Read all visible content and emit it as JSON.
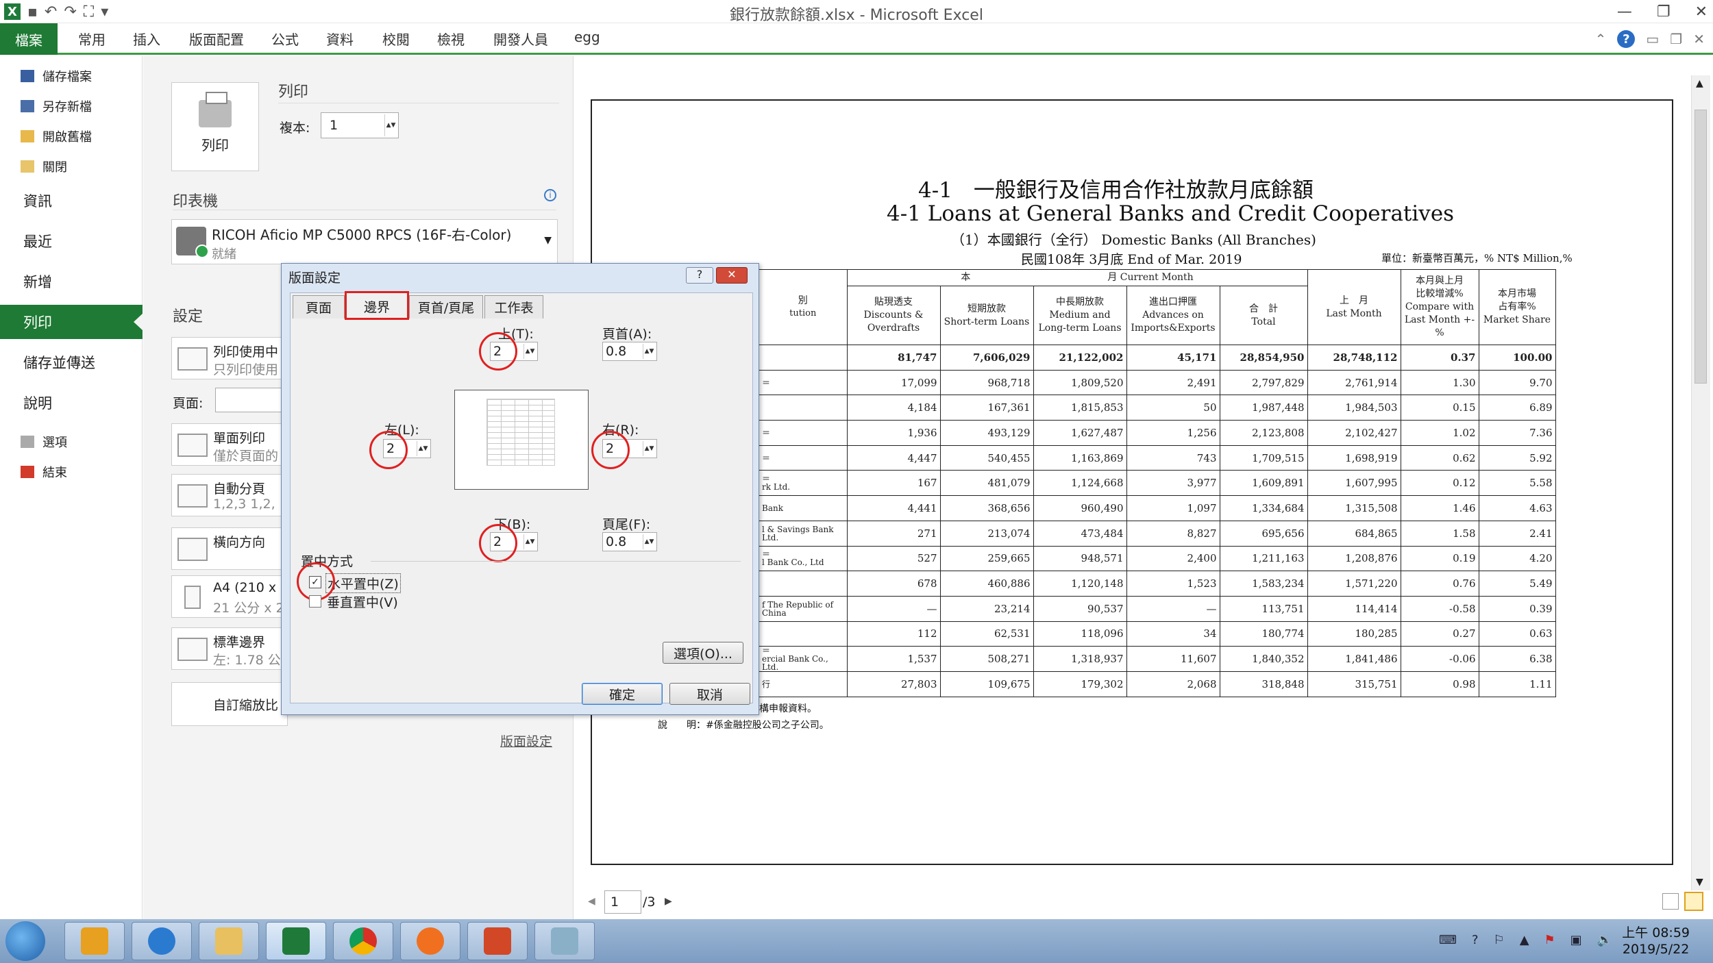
{
  "window": {
    "title": "銀行放款餘額.xlsx - Microsoft Excel",
    "tabs": [
      "檔案",
      "常用",
      "插入",
      "版面配置",
      "公式",
      "資料",
      "校閱",
      "檢視",
      "開發人員",
      "egg"
    ]
  },
  "nav": {
    "small_top": [
      "儲存檔案",
      "另存新檔",
      "開啟舊檔",
      "關閉"
    ],
    "big": [
      "資訊",
      "最近",
      "新增",
      "列印",
      "儲存並傳送",
      "說明"
    ],
    "small_bottom": [
      "選項",
      "結束"
    ]
  },
  "print_pane": {
    "title": "列印",
    "print_button": "列印",
    "copies_label": "複本:",
    "copies_value": "1",
    "printer_title": "印表機",
    "printer_name": "RICOH Aficio MP C5000 RPCS (16F-右-Color)",
    "printer_status": "就緒",
    "settings_title": "設定",
    "options": [
      {
        "t1": "列印使用中",
        "t2": "只列印使用"
      },
      {
        "t1": "單面列印",
        "t2": "僅於頁面的"
      },
      {
        "t1": "自動分頁",
        "t2": "1,2,3    1,2,"
      },
      {
        "t1": "橫向方向",
        "t2": ""
      },
      {
        "t1": "A4 (210 x 2",
        "t2": "21 公分 x 2"
      },
      {
        "t1": "標準邊界",
        "t2": "左: 1.78 公"
      }
    ],
    "pages_label": "頁面:",
    "scale_label": "自訂縮放比",
    "page_setup_link": "版面設定"
  },
  "dialog": {
    "title": "版面設定",
    "tabs": [
      "頁面",
      "邊界",
      "頁首/頁尾",
      "工作表"
    ],
    "top_label": "上(T):",
    "top": "2",
    "header_label": "頁首(A):",
    "header": "0.8",
    "left_label": "左(L):",
    "left": "2",
    "right_label": "右(R):",
    "right": "2",
    "bottom_label": "下(B):",
    "bottom": "2",
    "footer_label": "頁尾(F):",
    "footer": "0.8",
    "center_title": "置中方式",
    "horiz": "水平置中(Z)",
    "vert": "垂直置中(V)",
    "options_btn": "選項(O)...",
    "ok": "確定",
    "cancel": "取消"
  },
  "preview": {
    "title_zh": "4-1　一般銀行及信用合作社放款月底餘額",
    "title_en": "4-1 Loans at General Banks and Credit Cooperatives",
    "subtitle": "（1）本國銀行（全行）  Domestic Banks (All Branches)",
    "date": "民國108年  3月底  End of Mar. 2019",
    "unit": "單位：新臺幣百萬元，%  NT$ Million,%",
    "group_zh": "本",
    "group_en": "月  Current Month",
    "row_col_zh": "別",
    "row_col_en": "tution",
    "headers": [
      "貼現透支\nDiscounts &\nOverdrafts",
      "短期放款\nShort-term Loans",
      "中長期放款\nMedium and\nLong-term Loans",
      "進出口押匯\nAdvances on\nImports&Exports",
      "合　計\nTotal",
      "上　月\nLast Month",
      "本月與上月\n比較增減%\nCompare with\nLast Month +-%",
      "本月市場\n占有率%\nMarket Share"
    ],
    "row_labels": [
      "",
      "＝",
      "",
      "＝",
      "＝",
      "＝\nrk Ltd.",
      "Bank",
      "l & Savings Bank Ltd.",
      "＝\nl Bank Co., Ltd",
      "",
      "f The Republic of China",
      "",
      "＝\nercial Bank Co., Ltd.",
      "行"
    ],
    "rows": [
      [
        "81,747",
        "7,606,029",
        "21,122,002",
        "45,171",
        "28,854,950",
        "28,748,112",
        "0.37",
        "100.00"
      ],
      [
        "17,099",
        "968,718",
        "1,809,520",
        "2,491",
        "2,797,829",
        "2,761,914",
        "1.30",
        "9.70"
      ],
      [
        "4,184",
        "167,361",
        "1,815,853",
        "50",
        "1,987,448",
        "1,984,503",
        "0.15",
        "6.89"
      ],
      [
        "1,936",
        "493,129",
        "1,627,487",
        "1,256",
        "2,123,808",
        "2,102,427",
        "1.02",
        "7.36"
      ],
      [
        "4,447",
        "540,455",
        "1,163,869",
        "743",
        "1,709,515",
        "1,698,919",
        "0.62",
        "5.92"
      ],
      [
        "167",
        "481,079",
        "1,124,668",
        "3,977",
        "1,609,891",
        "1,607,995",
        "0.12",
        "5.58"
      ],
      [
        "4,441",
        "368,656",
        "960,490",
        "1,097",
        "1,334,684",
        "1,315,508",
        "1.46",
        "4.63"
      ],
      [
        "271",
        "213,074",
        "473,484",
        "8,827",
        "695,656",
        "684,865",
        "1.58",
        "2.41"
      ],
      [
        "527",
        "259,665",
        "948,571",
        "2,400",
        "1,211,163",
        "1,208,876",
        "0.19",
        "4.20"
      ],
      [
        "678",
        "460,886",
        "1,120,148",
        "1,523",
        "1,583,234",
        "1,571,220",
        "0.76",
        "5.49"
      ],
      [
        "—",
        "23,214",
        "90,537",
        "—",
        "113,751",
        "114,414",
        "-0.58",
        "0.39"
      ],
      [
        "112",
        "62,531",
        "118,096",
        "34",
        "180,774",
        "180,285",
        "0.27",
        "0.63"
      ],
      [
        "1,537",
        "508,271",
        "1,318,937",
        "11,607",
        "1,840,352",
        "1,841,486",
        "-0.06",
        "6.38"
      ],
      [
        "27,803",
        "109,675",
        "179,302",
        "2,068",
        "318,848",
        "315,751",
        "0.98",
        "1.11"
      ]
    ],
    "note1": "構申報資料。",
    "note2": "說　　明：#係金融控股公司之子公司。",
    "page_current": "1",
    "page_total": "/3"
  },
  "taskbar": {
    "time": "上午 08:59",
    "date": "2019/5/22"
  }
}
